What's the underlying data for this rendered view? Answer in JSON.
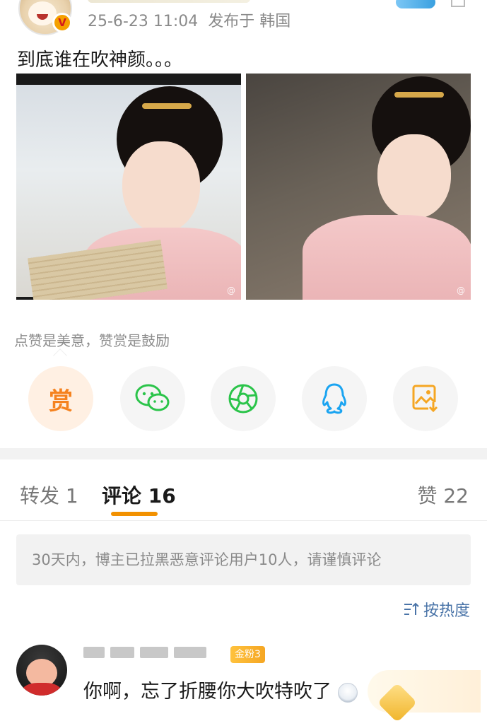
{
  "post": {
    "meta_time": "25-6-23 11:04",
    "meta_location": "发布于 韩国",
    "verified_badge": "V",
    "text": "到底谁在吹神颜。。。",
    "photo_watermark_1": "@",
    "photo_watermark_2": "@"
  },
  "reward": {
    "tip": "点赞是美意，赞赏是鼓励",
    "button_label": "赏"
  },
  "share": {
    "icons": [
      "wechat-icon",
      "moments-icon",
      "qq-icon",
      "save-image-icon"
    ]
  },
  "tabs": {
    "repost": "转发 1",
    "comments": "评论 16",
    "likes": "赞 22"
  },
  "notice": "30天内，博主已拉黑恶意评论用户10人，请谨慎评论",
  "sort": {
    "label": "按热度"
  },
  "comment": {
    "fan_badge": "金粉3",
    "text": "你啊，忘了折腰你大吹特吹了"
  },
  "colors": {
    "accent": "#f29100",
    "reward": "#f5821f",
    "wechat": "#2bc44a",
    "qq": "#1aa4f1",
    "link": "#4a74a8"
  }
}
